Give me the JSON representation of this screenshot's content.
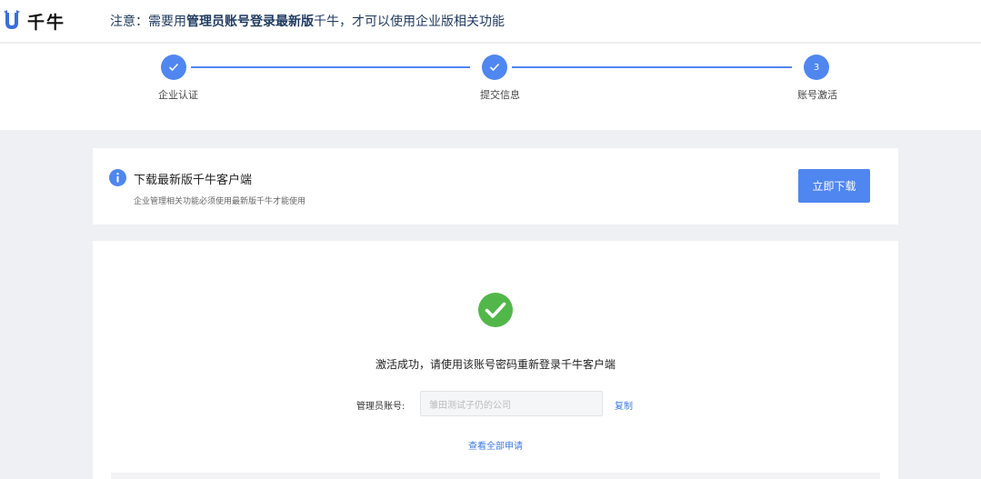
{
  "header": {
    "logo_text": "千牛",
    "logo_icon": "qianniu-logo-icon",
    "notice": {
      "prefix": "注意：需要用",
      "bold1": "管理员账号登录",
      "bold2": "最新版",
      "suffix": "千牛，才可以使用企业版相关功能"
    }
  },
  "steps": [
    {
      "label": "企业认证",
      "status": "done",
      "icon": "check-icon"
    },
    {
      "label": "提交信息",
      "status": "done",
      "icon": "check-icon"
    },
    {
      "label": "账号激活",
      "status": "current",
      "number": "3"
    }
  ],
  "download": {
    "icon": "info-icon",
    "title": "下载最新版千牛客户端",
    "subtitle": "企业管理相关功能必须使用最新版千牛才能使用",
    "button_label": "立即下载"
  },
  "result": {
    "icon": "success-check-icon",
    "message": "激活成功，请使用该账号密码重新登录千牛客户端",
    "account_label": "管理员账号:",
    "account_value": "雏田测试子仍的公司",
    "copy_label": "复制",
    "view_all_label": "查看全部申请"
  },
  "colors": {
    "primary": "#4f86f0",
    "success": "#52b749",
    "background": "#eff0f3"
  }
}
